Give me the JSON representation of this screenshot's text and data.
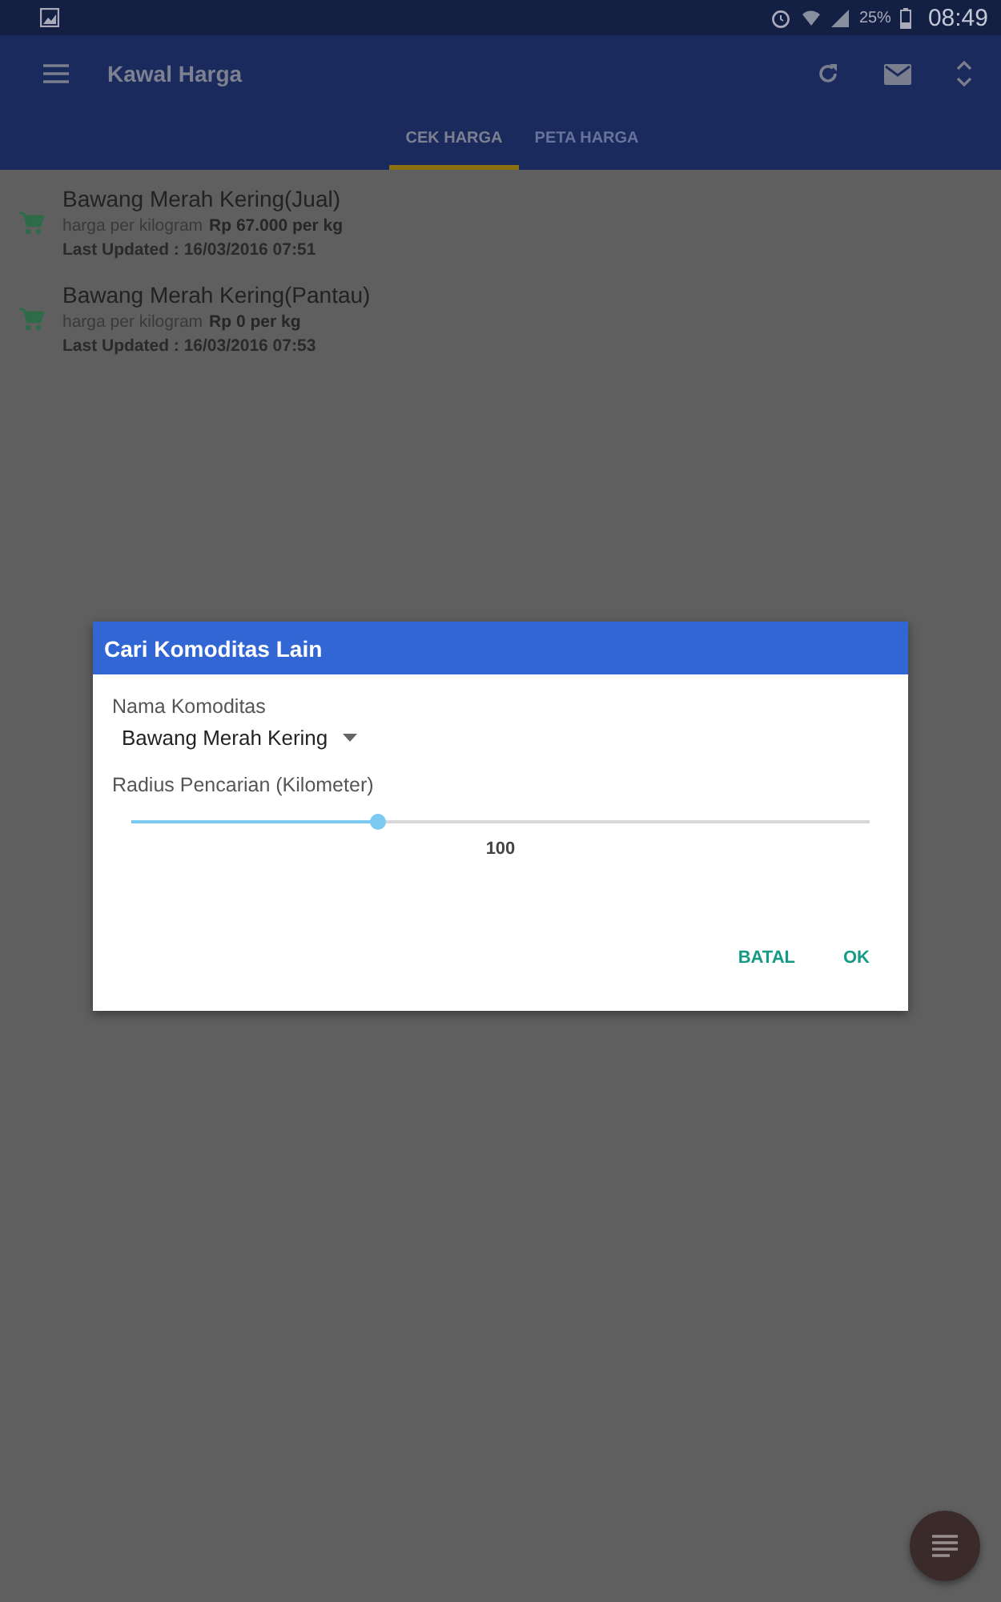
{
  "status_bar": {
    "battery": "25%",
    "time": "08:49"
  },
  "app_bar": {
    "title": "Kawal Harga"
  },
  "tabs": [
    {
      "label": "CEK HARGA",
      "selected": true
    },
    {
      "label": "PETA HARGA",
      "selected": false
    }
  ],
  "items": [
    {
      "name": "Bawang Merah Kering(Jual)",
      "price_label": "harga per kilogram",
      "price": "Rp 67.000 per kg",
      "updated": "Last Updated : 16/03/2016 07:51"
    },
    {
      "name": "Bawang Merah Kering(Pantau)",
      "price_label": "harga per kilogram",
      "price": "Rp 0 per kg",
      "updated": "Last Updated : 16/03/2016 07:53"
    }
  ],
  "dialog": {
    "title": "Cari Komoditas Lain",
    "commodity_label": "Nama Komoditas",
    "commodity_value": "Bawang Merah Kering",
    "radius_label": "Radius Pencarian (Kilometer)",
    "radius": {
      "level": 0.333,
      "reading": "100"
    },
    "buttons": [
      "BATAL",
      "OK"
    ]
  }
}
